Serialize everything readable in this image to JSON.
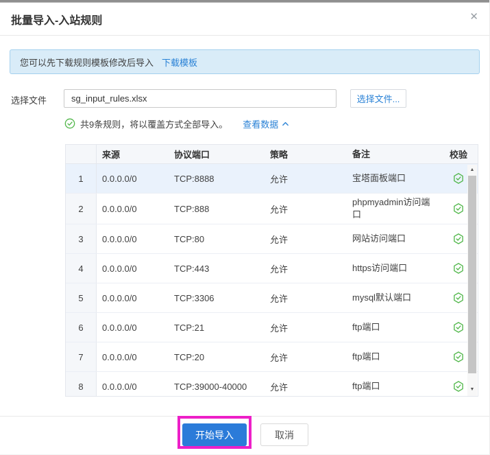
{
  "colors": {
    "accent_blue": "#2a82d6",
    "primary_button_blue": "#2b7bd9",
    "success_green": "#52b74b",
    "banner_bg": "#d9ecf8",
    "banner_border": "#a3d0ee",
    "row_highlight": "#eaf2fc",
    "annotation_magenta": "#ed1fc8"
  },
  "dialog": {
    "title": "批量导入-入站规则",
    "close_label": "✕"
  },
  "banner": {
    "message": "您可以先下载规则模板修改后导入",
    "link_label": "下载模板"
  },
  "file_picker": {
    "label": "选择文件",
    "file_name": "sg_input_rules.xlsx",
    "browse_label": "选择文件..."
  },
  "summary": {
    "message": "共9条规则，将以覆盖方式全部导入。",
    "link_label": "查看数据"
  },
  "table": {
    "headers": {
      "source": "来源",
      "port": "协议端口",
      "policy": "策略",
      "remark": "备注",
      "check": "校验"
    },
    "rows": [
      {
        "index": "1",
        "source": "0.0.0.0/0",
        "port": "TCP:8888",
        "policy": "允许",
        "remark": "宝塔面板端口",
        "valid": true,
        "highlighted": true
      },
      {
        "index": "2",
        "source": "0.0.0.0/0",
        "port": "TCP:888",
        "policy": "允许",
        "remark": "phpmyadmin访问端口",
        "valid": true,
        "highlighted": false
      },
      {
        "index": "3",
        "source": "0.0.0.0/0",
        "port": "TCP:80",
        "policy": "允许",
        "remark": "网站访问端口",
        "valid": true,
        "highlighted": false
      },
      {
        "index": "4",
        "source": "0.0.0.0/0",
        "port": "TCP:443",
        "policy": "允许",
        "remark": "https访问端口",
        "valid": true,
        "highlighted": false
      },
      {
        "index": "5",
        "source": "0.0.0.0/0",
        "port": "TCP:3306",
        "policy": "允许",
        "remark": "mysql默认端口",
        "valid": true,
        "highlighted": false
      },
      {
        "index": "6",
        "source": "0.0.0.0/0",
        "port": "TCP:21",
        "policy": "允许",
        "remark": "ftp端口",
        "valid": true,
        "highlighted": false
      },
      {
        "index": "7",
        "source": "0.0.0.0/0",
        "port": "TCP:20",
        "policy": "允许",
        "remark": "ftp端口",
        "valid": true,
        "highlighted": false
      },
      {
        "index": "8",
        "source": "0.0.0.0/0",
        "port": "TCP:39000-40000",
        "policy": "允许",
        "remark": "ftp端口",
        "valid": true,
        "highlighted": false
      }
    ]
  },
  "footer": {
    "confirm_label": "开始导入",
    "cancel_label": "取消"
  }
}
